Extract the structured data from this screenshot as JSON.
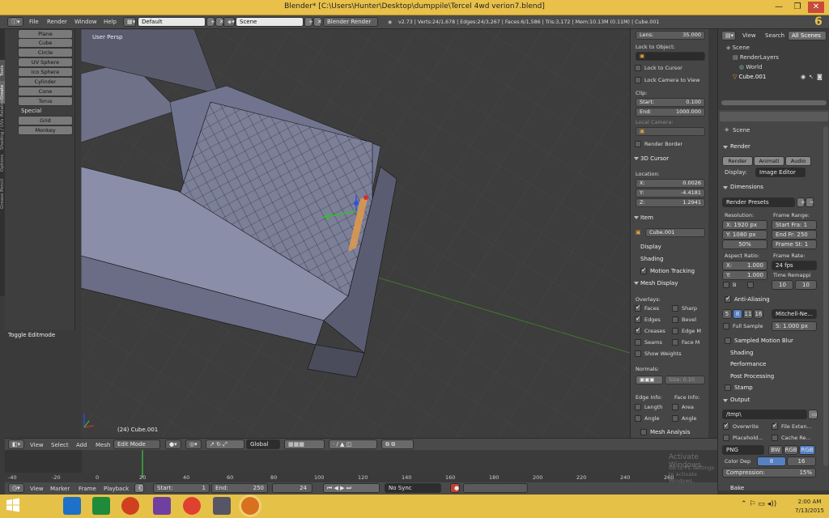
{
  "window": {
    "title": "Blender* [C:\\Users\\Hunter\\Desktop\\dumppile\\Tercel 4wd verion7.blend]",
    "minimize": "—",
    "maximize": "❐",
    "close": "✕"
  },
  "info_header": {
    "menus": [
      "File",
      "Render",
      "Window",
      "Help"
    ],
    "screen_layout": "Default",
    "scene": "Scene",
    "engine": "Blender Render",
    "stats": "v2.73 | Verts:24/1,678 | Edges:24/3,267 | Faces:6/1,586 | Tris:3,172 | Mem:10.13M (0.11M) | Cube.001"
  },
  "toolshelf": {
    "tabs": [
      "Tools",
      "Create",
      "Relations",
      "Shading / UVs",
      "Options",
      "Grease Pencil"
    ],
    "mesh_buttons": [
      "Plane",
      "Cube",
      "Circle",
      "UV Sphere",
      "Ico Sphere",
      "Cylinder",
      "Cone",
      "Torus"
    ],
    "special_label": "Special",
    "special_buttons": [
      "Grid",
      "Monkey"
    ],
    "operator_panel": "Toggle Editmode"
  },
  "viewport": {
    "label": "User Persp",
    "object_info": "(24) Cube.001",
    "colors": {
      "mesh": "#8f93ad",
      "grid": "#4a4a4a",
      "selected": "#e09a4c"
    }
  },
  "npanel": {
    "lens_label": "Lens:",
    "lens_value": "35.000",
    "lock_to_object": "Lock to Object:",
    "lock_to_cursor": "Lock to Cursor",
    "lock_camera": "Lock Camera to View",
    "clip": "Clip:",
    "clip_start_label": "Start:",
    "clip_start": "0.100",
    "clip_end_label": "End:",
    "clip_end": "1000.000",
    "local_camera": "Local Camera:",
    "render_border": "Render Border",
    "cursor_title": "3D Cursor",
    "location": "Location:",
    "x_label": "X:",
    "x": "0.0026",
    "y_label": "Y:",
    "y": "-4.4181",
    "z_label": "Z:",
    "z": "1.2941",
    "item_title": "Item",
    "item_name": "Cube.001",
    "display": "Display",
    "shading": "Shading",
    "motion_tracking": "Motion Tracking",
    "mesh_display": "Mesh Display",
    "overlays": "Overlays:",
    "ov_faces": "Faces",
    "ov_sharp": "Sharp",
    "ov_edges": "Edges",
    "ov_bevel": "Bevel",
    "ov_creases": "Creases",
    "ov_edgem": "Edge M",
    "ov_seams": "Seams",
    "ov_facem": "Face M",
    "show_weights": "Show Weights",
    "normals": "Normals:",
    "normal_size": "Size:  0.10",
    "edge_info": "Edge Info:",
    "face_info": "Face Info:",
    "length": "Length",
    "area": "Area",
    "angle1": "Angle",
    "angle2": "Angle",
    "mesh_analysis": "Mesh Analysis"
  },
  "outliner": {
    "menu_view": "View",
    "menu_search": "Search",
    "filter": "All Scenes",
    "items": [
      "Scene",
      "RenderLayers",
      "World",
      "Cube.001"
    ]
  },
  "properties": {
    "scene_crumb": "Scene",
    "render_title": "Render",
    "render_btn": "Render",
    "anim_btn": "Animati",
    "audio_btn": "Audio",
    "display_label": "Display:",
    "display_value": "Image Editor",
    "dimensions": "Dimensions",
    "render_presets": "Render Presets",
    "resolution": "Resolution:",
    "res_x": "X: 1920 px",
    "res_y": "Y: 1080 px",
    "res_pct": "50%",
    "frame_range": "Frame Range:",
    "start_frame": "Start Fra: 1",
    "end_frame": "End Fr: 250",
    "frame_step": "Frame St: 1",
    "aspect": "Aspect Ratio:",
    "aspect_x_label": "X:",
    "aspect_x": "1.000",
    "aspect_y_label": "Y:",
    "aspect_y": "1.000",
    "frame_rate": "Frame Rate:",
    "fps": "24 fps",
    "time_remap": "Time Remappi",
    "b_label": "B",
    "remap_old": "10",
    "remap_new": "10",
    "anti_aliasing": "Anti-Aliasing",
    "aa5": "5",
    "aa8": "8",
    "aa11": "11",
    "aa16": "16",
    "aa_filter": "Mitchell-Ne...",
    "full_sample": "Full Sample",
    "aa_size": "S: 1.000 px",
    "sampled_motion_blur": "Sampled Motion Blur",
    "shading": "Shading",
    "performance": "Performance",
    "post_processing": "Post Processing",
    "stamp": "Stamp",
    "output": "Output",
    "output_path": "/tmp\\",
    "overwrite": "Overwrite",
    "file_ext": "File Exten...",
    "placeholders": "Placehold...",
    "cache_result": "Cache Re...",
    "format": "PNG",
    "bw": "BW",
    "rgb": "RGB",
    "rgba": "RGB",
    "color_depth": "Color Dep",
    "depth8": "8",
    "depth16": "16",
    "compression": "Compression:",
    "compression_value": "15%",
    "bake": "Bake"
  },
  "viewport_header": {
    "menus": [
      "View",
      "Select",
      "Add",
      "Mesh"
    ],
    "mode": "Edit Mode",
    "orientation": "Global"
  },
  "timeline": {
    "ticks": [
      "-40",
      "-20",
      "0",
      "20",
      "40",
      "60",
      "80",
      "100",
      "120",
      "140",
      "160",
      "180",
      "200",
      "220",
      "240",
      "260"
    ],
    "watermark1": "Activate Windows",
    "watermark2": "Go to PC settings to activate Windows."
  },
  "timeline_header": {
    "menus": [
      "View",
      "Marker",
      "Frame",
      "Playback"
    ],
    "start_label": "Start:",
    "start": "1",
    "end_label": "End:",
    "end": "250",
    "current": "24",
    "sync": "No Sync"
  },
  "taskbar": {
    "time": "2:00 AM",
    "date": "7/13/2015",
    "badge": "6"
  }
}
